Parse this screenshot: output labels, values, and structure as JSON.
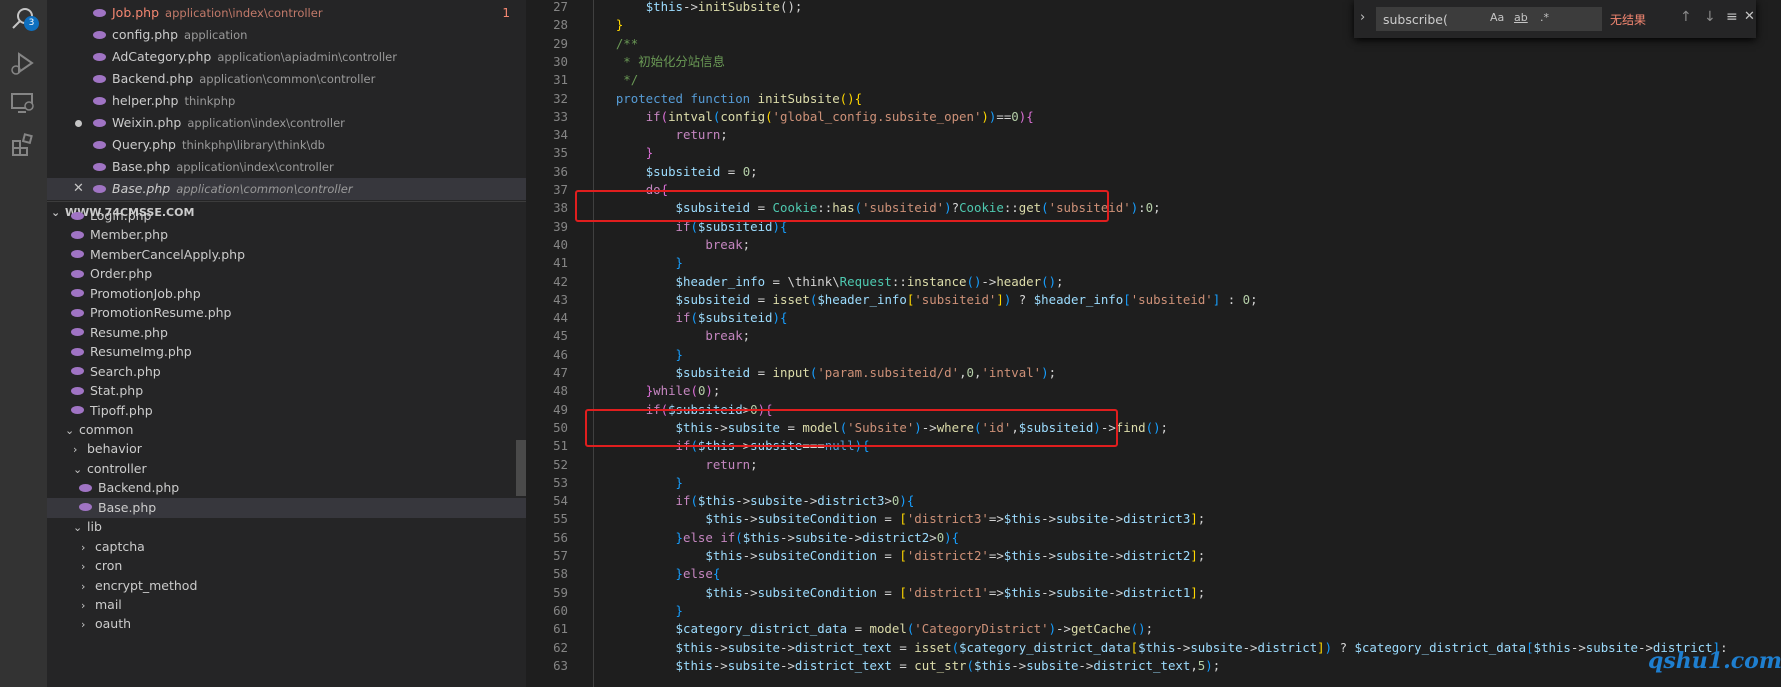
{
  "activity_bar": {
    "search_badge": "3",
    "icons": [
      "search-icon",
      "debug-icon",
      "remote-explorer-icon",
      "extensions-icon"
    ]
  },
  "open_editors": [
    {
      "file": "Job.php",
      "path": "application\\index\\controller",
      "modified": true,
      "problems": "1"
    },
    {
      "file": "config.php",
      "path": "application"
    },
    {
      "file": "AdCategory.php",
      "path": "application\\apiadmin\\controller"
    },
    {
      "file": "Backend.php",
      "path": "application\\common\\controller"
    },
    {
      "file": "helper.php",
      "path": "thinkphp"
    },
    {
      "file": "Weixin.php",
      "path": "application\\index\\controller",
      "dirty": true
    },
    {
      "file": "Query.php",
      "path": "thinkphp\\library\\think\\db"
    },
    {
      "file": "Base.php",
      "path": "application\\index\\controller"
    },
    {
      "file": "Base.php",
      "path": "application\\common\\controller",
      "active": true
    }
  ],
  "workspace_title": "WWW.74CMSSE.COM",
  "tree": [
    {
      "label": "Login.php",
      "type": "file",
      "indent": 1
    },
    {
      "label": "Member.php",
      "type": "file",
      "indent": 1
    },
    {
      "label": "MemberCancelApply.php",
      "type": "file",
      "indent": 1
    },
    {
      "label": "Order.php",
      "type": "file",
      "indent": 1
    },
    {
      "label": "PromotionJob.php",
      "type": "file",
      "indent": 1
    },
    {
      "label": "PromotionResume.php",
      "type": "file",
      "indent": 1
    },
    {
      "label": "Resume.php",
      "type": "file",
      "indent": 1
    },
    {
      "label": "ResumeImg.php",
      "type": "file",
      "indent": 1
    },
    {
      "label": "Search.php",
      "type": "file",
      "indent": 1
    },
    {
      "label": "Stat.php",
      "type": "file",
      "indent": 1
    },
    {
      "label": "Tipoff.php",
      "type": "file",
      "indent": 1
    },
    {
      "label": "common",
      "type": "folder-open",
      "indent": 0
    },
    {
      "label": "behavior",
      "type": "folder",
      "indent": 1
    },
    {
      "label": "controller",
      "type": "folder-open",
      "indent": 1
    },
    {
      "label": "Backend.php",
      "type": "file",
      "indent": 2
    },
    {
      "label": "Base.php",
      "type": "file",
      "indent": 2,
      "selected": true
    },
    {
      "label": "lib",
      "type": "folder-open",
      "indent": 1
    },
    {
      "label": "captcha",
      "type": "folder",
      "indent": 2
    },
    {
      "label": "cron",
      "type": "folder",
      "indent": 2
    },
    {
      "label": "encrypt_method",
      "type": "folder",
      "indent": 2
    },
    {
      "label": "mail",
      "type": "folder",
      "indent": 2
    },
    {
      "label": "oauth",
      "type": "folder",
      "indent": 2
    }
  ],
  "find_widget": {
    "query": "subscribe(",
    "opt_case": "Aa",
    "opt_word": "ab",
    "opt_regex": ".*",
    "result": "无结果",
    "prev": "↑",
    "next": "↓",
    "selection": "≡",
    "close": "✕"
  },
  "code_lines": [
    {
      "n": "27",
      "html": "        <span class='v'>$this</span>-&gt;<span class='f'>initSubsite</span>();"
    },
    {
      "n": "28",
      "html": "    <span class='b'>}</span>"
    },
    {
      "n": "29",
      "html": "    <span class='c'>/**</span>"
    },
    {
      "n": "30",
      "html": "<span class='c'>     * 初始化分站信息</span>"
    },
    {
      "n": "31",
      "html": "<span class='c'>     */</span>"
    },
    {
      "n": "32",
      "html": "    <span class='k'>protected</span> <span class='k'>function</span> <span class='f'>initSubsite</span><span class='b'>()</span><span class='b'>{</span>"
    },
    {
      "n": "33",
      "html": "        <span class='ctl'>if</span><span class='b2'>(</span><span class='f'>intval</span><span class='b3'>(</span><span class='f'>config</span><span class='b'>(</span><span class='s'>'global_config.subsite_open'</span><span class='b'>)</span><span class='b3'>)</span>==<span class='n'>0</span><span class='b2'>)</span><span class='b2'>{</span>"
    },
    {
      "n": "34",
      "html": "            <span class='ctl'>return</span>;"
    },
    {
      "n": "35",
      "html": "        <span class='b2'>}</span>"
    },
    {
      "n": "36",
      "html": "        <span class='v'>$subsiteid</span> = <span class='n'>0</span>;"
    },
    {
      "n": "37",
      "html": "        <span class='ctl'>do</span><span class='b2'>{</span>"
    },
    {
      "n": "38",
      "html": "            <span class='v'>$subsiteid</span> = <span class='cl'>Cookie</span>::<span class='f'>has</span><span class='b3'>(</span><span class='s'>'subsiteid'</span><span class='b3'>)</span>?<span class='cl'>Cookie</span>::<span class='f'>get</span><span class='b3'>(</span><span class='s'>'subsiteid'</span><span class='b3'>)</span>:<span class='n'>0</span>;"
    },
    {
      "n": "39",
      "html": "            <span class='ctl'>if</span><span class='b3'>(</span><span class='v'>$subsiteid</span><span class='b3'>)</span><span class='b3'>{</span>"
    },
    {
      "n": "40",
      "html": "                <span class='ctl'>break</span>;"
    },
    {
      "n": "41",
      "html": "            <span class='b3'>}</span>"
    },
    {
      "n": "42",
      "html": "            <span class='v'>$header_info</span> = \\think\\<span class='cl'>Request</span>::<span class='f'>instance</span><span class='b3'>()</span>-&gt;<span class='f'>header</span><span class='b3'>()</span>;"
    },
    {
      "n": "43",
      "html": "            <span class='v'>$subsiteid</span> = <span class='f'>isset</span><span class='b3'>(</span><span class='v'>$header_info</span><span class='b'>[</span><span class='s'>'subsiteid'</span><span class='b'>]</span><span class='b3'>)</span> ? <span class='v'>$header_info</span><span class='b3'>[</span><span class='s'>'subsiteid'</span><span class='b3'>]</span> : <span class='n'>0</span>;"
    },
    {
      "n": "44",
      "html": "            <span class='ctl'>if</span><span class='b3'>(</span><span class='v'>$subsiteid</span><span class='b3'>)</span><span class='b3'>{</span>"
    },
    {
      "n": "45",
      "html": "                <span class='ctl'>break</span>;"
    },
    {
      "n": "46",
      "html": "            <span class='b3'>}</span>"
    },
    {
      "n": "47",
      "html": "            <span class='v'>$subsiteid</span> = <span class='f'>input</span><span class='b3'>(</span><span class='s'>'param.subsiteid/d'</span>,<span class='n'>0</span>,<span class='s'>'intval'</span><span class='b3'>)</span>;"
    },
    {
      "n": "48",
      "html": "        <span class='b2'>}</span><span class='ctl'>while</span><span class='b2'>(</span><span class='n'>0</span><span class='b2'>)</span>;"
    },
    {
      "n": "49",
      "html": "        <span class='ctl'>if</span><span class='b2'>(</span><span class='v'>$subsiteid</span>&gt;<span class='n'>0</span><span class='b2'>)</span><span class='b2'>{</span>"
    },
    {
      "n": "50",
      "html": "            <span class='v'>$this</span>-&gt;<span class='v'>subsite</span> = <span class='f'>model</span><span class='b3'>(</span><span class='s'>'Subsite'</span><span class='b3'>)</span>-&gt;<span class='f'>where</span><span class='b3'>(</span><span class='s'>'id'</span>,<span class='v'>$subsiteid</span><span class='b3'>)</span>-&gt;<span class='f'>find</span><span class='b3'>()</span>;"
    },
    {
      "n": "51",
      "html": "            <span class='ctl'>if</span><span class='b3'>(</span><span class='v'>$this</span>-&gt;<span class='v'>subsite</span>===<span class='k'>null</span><span class='b3'>)</span><span class='b3'>{</span>"
    },
    {
      "n": "52",
      "html": "                <span class='ctl'>return</span>;"
    },
    {
      "n": "53",
      "html": "            <span class='b3'>}</span>"
    },
    {
      "n": "54",
      "html": "            <span class='ctl'>if</span><span class='b3'>(</span><span class='v'>$this</span>-&gt;<span class='v'>subsite</span>-&gt;<span class='v'>district3</span>&gt;<span class='n'>0</span><span class='b3'>)</span><span class='b3'>{</span>"
    },
    {
      "n": "55",
      "html": "                <span class='v'>$this</span>-&gt;<span class='v'>subsiteCondition</span> = <span class='b'>[</span><span class='s'>'district3'</span>=&gt;<span class='v'>$this</span>-&gt;<span class='v'>subsite</span>-&gt;<span class='v'>district3</span><span class='b'>]</span>;"
    },
    {
      "n": "56",
      "html": "            <span class='b3'>}</span><span class='ctl'>else</span> <span class='ctl'>if</span><span class='b3'>(</span><span class='v'>$this</span>-&gt;<span class='v'>subsite</span>-&gt;<span class='v'>district2</span>&gt;<span class='n'>0</span><span class='b3'>)</span><span class='b3'>{</span>"
    },
    {
      "n": "57",
      "html": "                <span class='v'>$this</span>-&gt;<span class='v'>subsiteCondition</span> = <span class='b'>[</span><span class='s'>'district2'</span>=&gt;<span class='v'>$this</span>-&gt;<span class='v'>subsite</span>-&gt;<span class='v'>district2</span><span class='b'>]</span>;"
    },
    {
      "n": "58",
      "html": "            <span class='b3'>}</span><span class='ctl'>else</span><span class='b3'>{</span>"
    },
    {
      "n": "59",
      "html": "                <span class='v'>$this</span>-&gt;<span class='v'>subsiteCondition</span> = <span class='b'>[</span><span class='s'>'district1'</span>=&gt;<span class='v'>$this</span>-&gt;<span class='v'>subsite</span>-&gt;<span class='v'>district1</span><span class='b'>]</span>;"
    },
    {
      "n": "60",
      "html": "            <span class='b3'>}</span>"
    },
    {
      "n": "61",
      "html": "            <span class='v'>$category_district_data</span> = <span class='f'>model</span><span class='b3'>(</span><span class='s'>'CategoryDistrict'</span><span class='b3'>)</span>-&gt;<span class='f'>getCache</span><span class='b3'>()</span>;"
    },
    {
      "n": "62",
      "html": "            <span class='v'>$this</span>-&gt;<span class='v'>subsite</span>-&gt;<span class='v'>district_text</span> = <span class='f'>isset</span><span class='b3'>(</span><span class='v'>$category_district_data</span><span class='b'>[</span><span class='v'>$this</span>-&gt;<span class='v'>subsite</span>-&gt;<span class='v'>district</span><span class='b'>]</span><span class='b3'>)</span> ? <span class='v'>$category_district_data</span><span class='b3'>[</span><span class='v'>$this</span>-&gt;<span class='v'>subsite</span>-&gt;<span class='v'>district</span><span class='b3'>]</span>:"
    },
    {
      "n": "63",
      "html": "            <span class='v'>$this</span>-&gt;<span class='v'>subsite</span>-&gt;<span class='v'>district_text</span> = <span class='f'>cut_str</span><span class='b3'>(</span><span class='v'>$this</span>-&gt;<span class='v'>subsite</span>-&gt;<span class='v'>district_text</span>,<span class='n'>5</span><span class='b3'>)</span>;"
    }
  ],
  "watermark": "qshu1.com"
}
